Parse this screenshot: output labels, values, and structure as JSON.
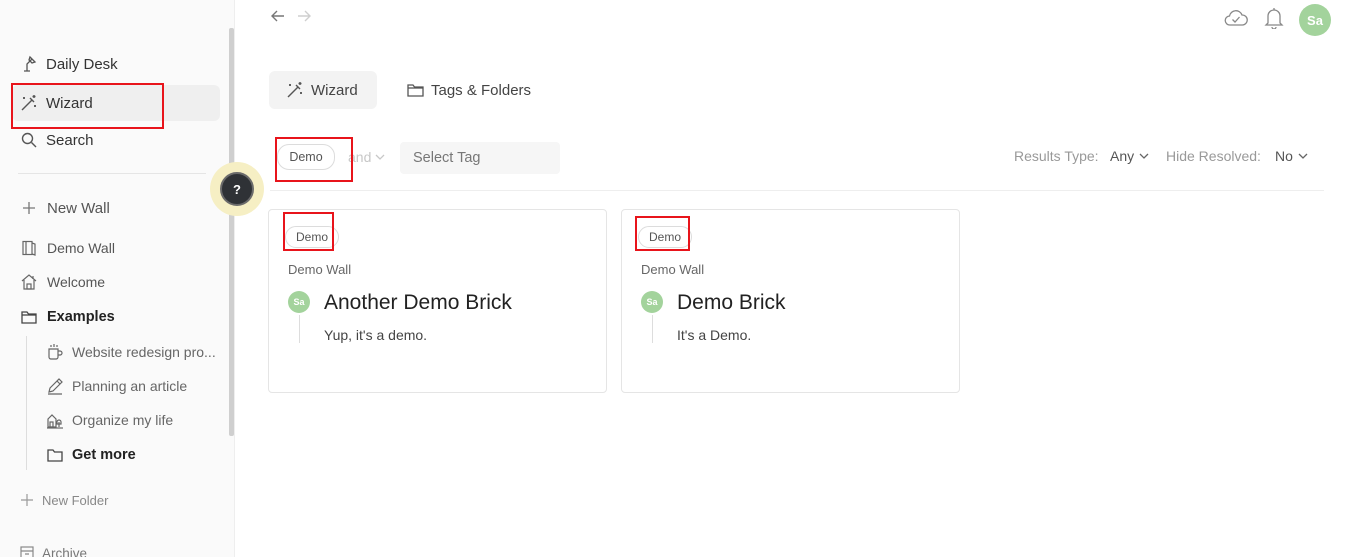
{
  "sidebar": {
    "nav": [
      {
        "label": "Daily Desk",
        "icon": "desk-lamp-icon"
      },
      {
        "label": "Wizard",
        "icon": "magic-wand-icon"
      },
      {
        "label": "Search",
        "icon": "search-icon"
      }
    ],
    "new_wall": "New Wall",
    "walls": [
      {
        "label": "Demo Wall",
        "icon": "wall-book-icon"
      },
      {
        "label": "Welcome",
        "icon": "house-icon"
      }
    ],
    "folder": {
      "label": "Examples",
      "icon": "folder-icon",
      "items": [
        {
          "label": "Website redesign pro...",
          "icon": "cup-icon"
        },
        {
          "label": "Planning an article",
          "icon": "pencil-icon"
        },
        {
          "label": "Organize my life",
          "icon": "garden-icon"
        },
        {
          "label": "Get more",
          "icon": "folder-icon"
        }
      ]
    },
    "new_folder": "New Folder",
    "archive": "Archive"
  },
  "help": {
    "label": "?"
  },
  "topbar": {
    "back_icon": "arrow-left-icon",
    "forward_icon": "arrow-right-icon",
    "cloud_icon": "cloud-sync-icon",
    "bell_icon": "bell-icon",
    "avatar_initials": "Sa"
  },
  "tabs": [
    {
      "label": "Wizard",
      "icon": "magic-wand-icon",
      "active": true
    },
    {
      "label": "Tags & Folders",
      "icon": "folder-icon",
      "active": false
    }
  ],
  "filter": {
    "selected_tag": "Demo",
    "operator": "and",
    "tag_placeholder": "Select Tag",
    "results_type_label": "Results Type:",
    "results_type_value": "Any",
    "hide_resolved_label": "Hide Resolved:",
    "hide_resolved_value": "No"
  },
  "cards": [
    {
      "tag": "Demo",
      "wall": "Demo Wall",
      "author_initials": "Sa",
      "title": "Another Demo Brick",
      "text": "Yup, it's a demo."
    },
    {
      "tag": "Demo",
      "wall": "Demo Wall",
      "author_initials": "Sa",
      "title": "Demo Brick",
      "text": "It's a Demo."
    }
  ],
  "colors": {
    "accent_green": "#a3d39c",
    "annotation_red": "#e8141b",
    "help_dark": "#2f3236"
  }
}
